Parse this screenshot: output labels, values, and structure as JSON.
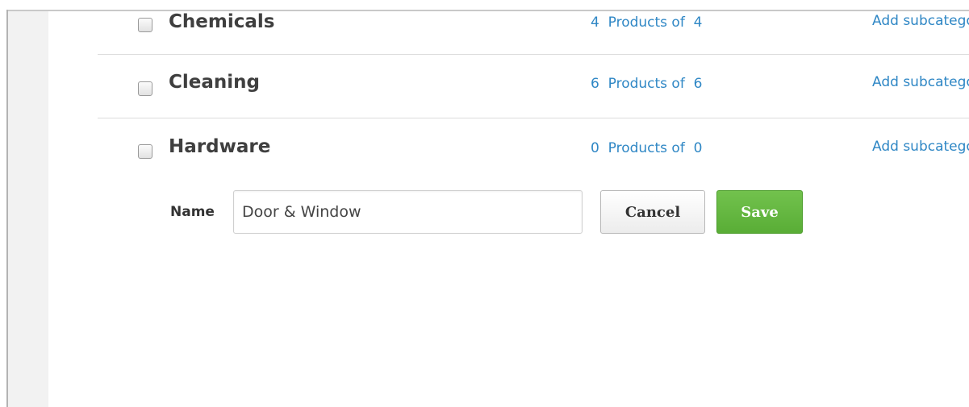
{
  "categories": [
    {
      "name": "Chemicals",
      "products": "4  Products of  4",
      "add_subcategory": "Add subcategory"
    },
    {
      "name": "Cleaning",
      "products": "6  Products of  6",
      "add_subcategory": "Add subcategory"
    },
    {
      "name": "Hardware",
      "products": "0  Products of  0",
      "add_subcategory": "Add subcategory"
    }
  ],
  "subcategory_form": {
    "label": "Name",
    "value": "Door & Window",
    "cancel_label": "Cancel",
    "save_label": "Save"
  },
  "colors": {
    "link": "#2f87c5",
    "save_button": "#5fb43b",
    "divider": "#dddddd"
  }
}
